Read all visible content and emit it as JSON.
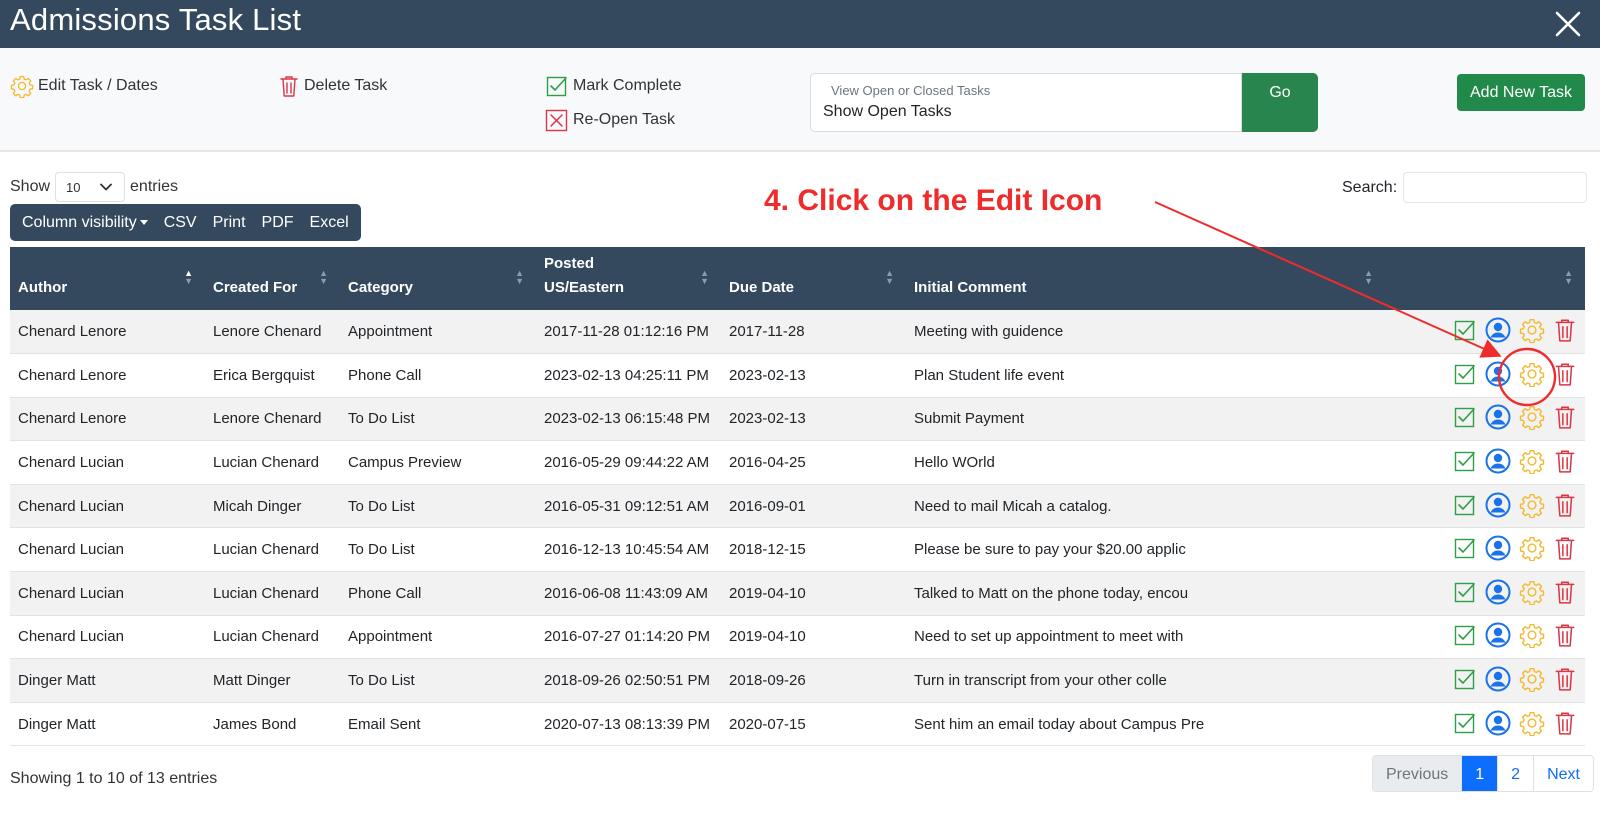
{
  "window": {
    "title": "Admissions Task List",
    "close_icon": "close-icon"
  },
  "toolbar": {
    "legend": {
      "edit": "Edit Task / Dates",
      "delete": "Delete Task",
      "complete": "Mark Complete",
      "reopen": "Re-Open Task"
    },
    "filter": {
      "label": "View Open or Closed Tasks",
      "value": "Show Open Tasks"
    },
    "go_label": "Go",
    "add_label": "Add New Task"
  },
  "controls": {
    "show_label": "Show",
    "entries_value": "10",
    "entries_label": "entries",
    "search_label": "Search:",
    "buttons": [
      "Column visibility",
      "CSV",
      "Print",
      "PDF",
      "Excel"
    ]
  },
  "annotation": {
    "text": "4. Click on the Edit Icon"
  },
  "table": {
    "headers": [
      "Author",
      "Created For",
      "Category",
      "Posted US/Eastern",
      "Due Date",
      "Initial Comment"
    ],
    "header_posted_line1": "Posted",
    "header_posted_line2": "US/Eastern",
    "rows": [
      [
        "Chenard Lenore",
        "Lenore Chenard",
        "Appointment",
        "2017-11-28 01:12:16 PM",
        "2017-11-28",
        "Meeting with guidence"
      ],
      [
        "Chenard Lenore",
        "Erica Bergquist",
        "Phone Call",
        "2023-02-13 04:25:11 PM",
        "2023-02-13",
        "Plan Student life event"
      ],
      [
        "Chenard Lenore",
        "Lenore Chenard",
        "To Do List",
        "2023-02-13 06:15:48 PM",
        "2023-02-13",
        "Submit Payment"
      ],
      [
        "Chenard Lucian",
        "Lucian Chenard",
        "Campus Preview",
        "2016-05-29 09:44:22 AM",
        "2016-04-25",
        "Hello WOrld"
      ],
      [
        "Chenard Lucian",
        "Micah Dinger",
        "To Do List",
        "2016-05-31 09:12:51 AM",
        "2016-09-01",
        "Need to mail Micah a catalog."
      ],
      [
        "Chenard Lucian",
        "Lucian Chenard",
        "To Do List",
        "2016-12-13 10:45:54 AM",
        "2018-12-15",
        "Please be sure to pay your $20.00 applic"
      ],
      [
        "Chenard Lucian",
        "Lucian Chenard",
        "Phone Call",
        "2016-06-08 11:43:09 AM",
        "2019-04-10",
        "Talked to Matt on the phone today, encou"
      ],
      [
        "Chenard Lucian",
        "Lucian Chenard",
        "Appointment",
        "2016-07-27 01:14:20 PM",
        "2019-04-10",
        "Need to set up appointment to meet with"
      ],
      [
        "Dinger Matt",
        "Matt Dinger",
        "To Do List",
        "2018-09-26 02:50:51 PM",
        "2018-09-26",
        "Turn in transcript from your other colle"
      ],
      [
        "Dinger Matt",
        "James Bond",
        "Email Sent",
        "2020-07-13 08:13:39 PM",
        "2020-07-15",
        "Sent him an email today about Campus Pre"
      ]
    ]
  },
  "footer": {
    "showing": "Showing 1 to 10 of 13 entries",
    "pages": [
      "Previous",
      "1",
      "2",
      "Next"
    ],
    "active_page": "1"
  },
  "colors": {
    "header_bg": "#34495e",
    "go_green": "#28854e",
    "complete_green": "#2e9e47",
    "user_blue": "#1a73e8",
    "gear_yellow": "#f5b82e",
    "trash_red": "#dc3545",
    "annotation_red": "#ee2c2c"
  }
}
